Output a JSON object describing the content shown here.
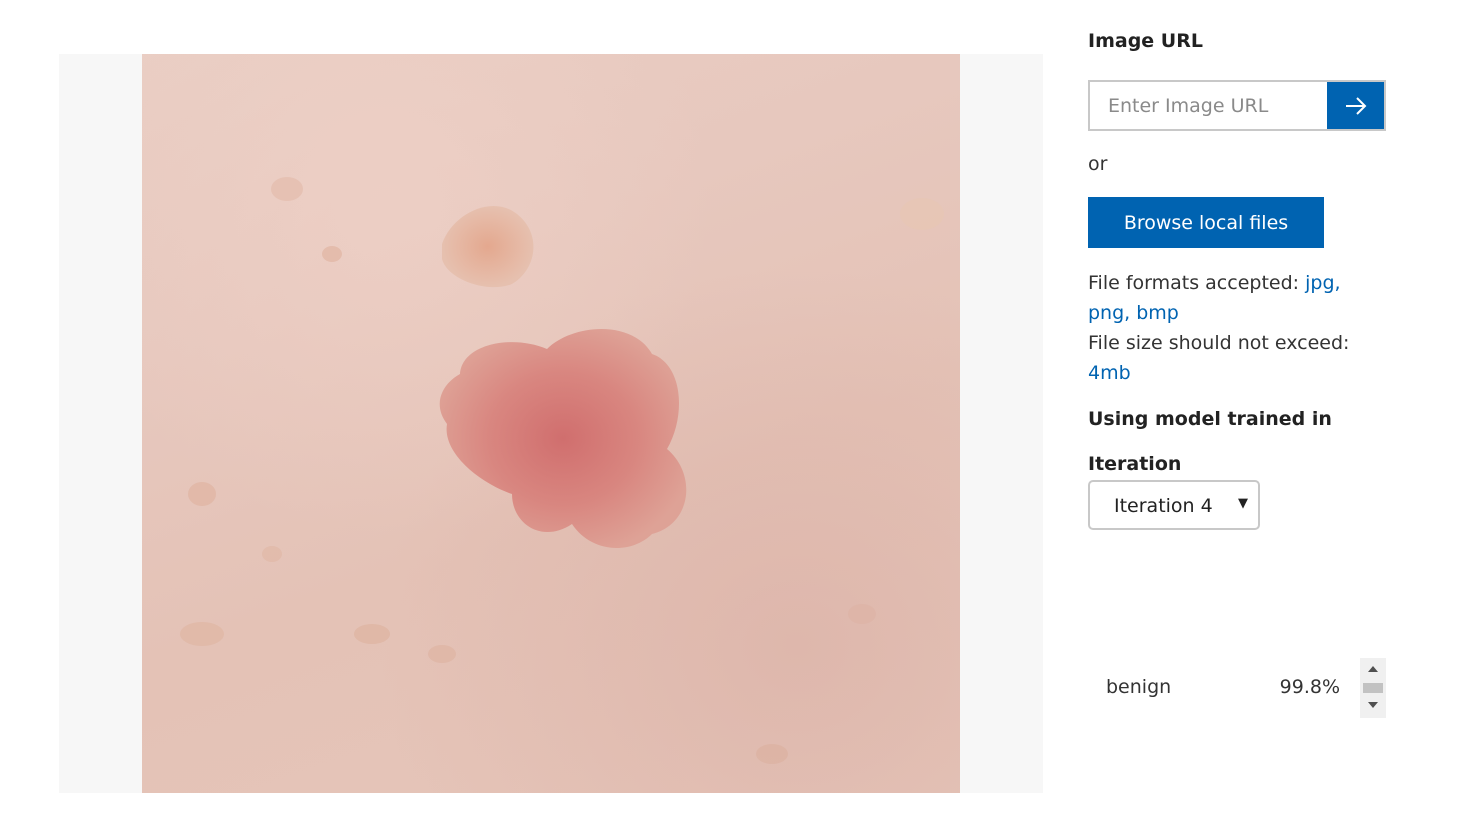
{
  "image_url": {
    "label": "Image URL",
    "placeholder": "Enter Image URL",
    "submit_icon": "arrow-right-icon"
  },
  "or_text": "or",
  "browse_button": "Browse local files",
  "file_info": {
    "formats_prefix": "File formats accepted:",
    "formats": "jpg, png, bmp",
    "size_prefix": "File size should not exceed:",
    "size": "4mb"
  },
  "model_label": "Using model trained in",
  "iteration": {
    "label": "Iteration",
    "selected": "Iteration 4"
  },
  "results": [
    {
      "tag": "benign",
      "probability": "99.8%"
    }
  ],
  "colors": {
    "accent": "#0063b1",
    "link": "#0063b1",
    "image_panel_bg": "#f7f7f7"
  }
}
